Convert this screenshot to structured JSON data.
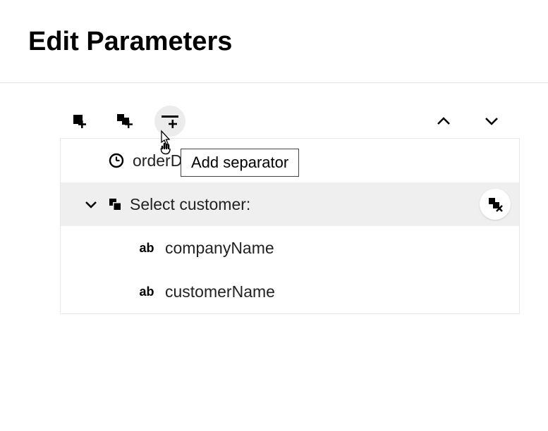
{
  "header": {
    "title": "Edit Parameters"
  },
  "toolbar": {
    "addItemTooltip": "Add item",
    "addGroupTooltip": "Add group",
    "addSeparatorTooltip": "Add separator",
    "moveUpTooltip": "Move up",
    "moveDownTooltip": "Move down"
  },
  "tooltip": {
    "text": "Add separator"
  },
  "rows": {
    "orderDate": {
      "label": "orderDate",
      "type": "time"
    },
    "selectCustomer": {
      "label": "Select customer:",
      "type": "group"
    },
    "companyName": {
      "label": "companyName",
      "type": "ab"
    },
    "customerName": {
      "label": "customerName",
      "type": "ab"
    }
  },
  "typeIndicators": {
    "ab": "ab"
  }
}
